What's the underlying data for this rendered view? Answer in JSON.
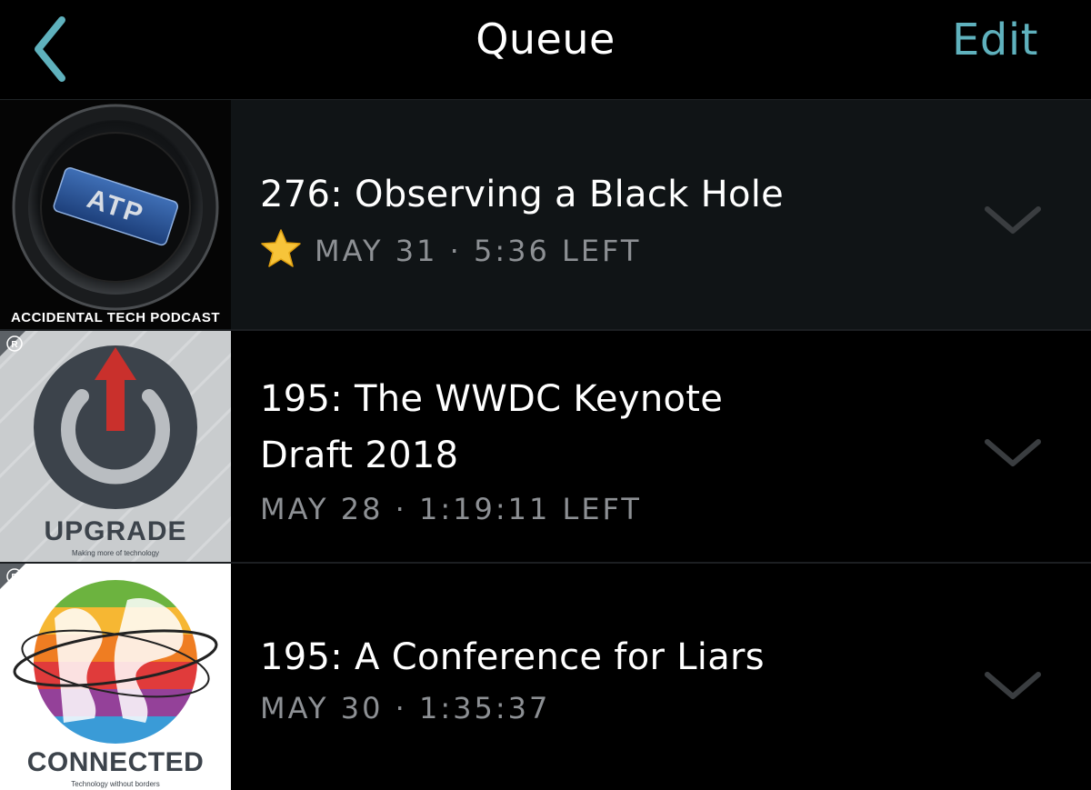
{
  "nav": {
    "title": "Queue",
    "edit_label": "Edit",
    "back_icon": "chevron-left-icon",
    "accent_color": "#5fb1bd"
  },
  "episodes": [
    {
      "podcast": "ACCIDENTAL TECH PODCAST",
      "art_badge": "ATP",
      "title_lines": [
        "276: Observing a Black Hole"
      ],
      "starred": true,
      "meta": "MAY 31 · 5:36 LEFT"
    },
    {
      "podcast": "UPGRADE",
      "podcast_tagline": "Making more of technology",
      "title_lines": [
        "195: The WWDC Keynote",
        "Draft 2018"
      ],
      "starred": false,
      "meta": "MAY 28 · 1:19:11 LEFT"
    },
    {
      "podcast": "CONNECTED",
      "podcast_tagline": "Technology without borders",
      "title_lines": [
        "195: A Conference for Liars"
      ],
      "starred": false,
      "meta": "MAY 30 · 1:35:37"
    }
  ]
}
